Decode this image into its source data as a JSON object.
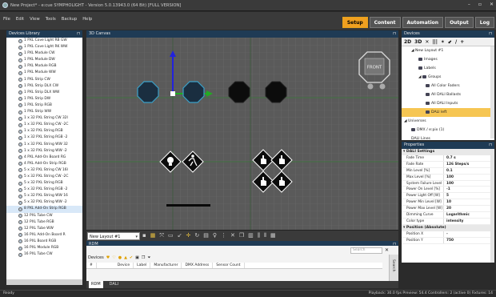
{
  "window": {
    "title": "New Project* - e:cue SYMPHOLIGHT - Version 5.0.13943.0 (64 Bit) [FULL VERSION]"
  },
  "menu": [
    "File",
    "Edit",
    "View",
    "Tools",
    "Backup",
    "Help"
  ],
  "tabs": [
    {
      "label": "Setup",
      "active": true
    },
    {
      "label": "Content",
      "active": false
    },
    {
      "label": "Automation",
      "active": false
    },
    {
      "label": "Output",
      "active": false
    },
    {
      "label": "Log",
      "active": false
    }
  ],
  "library": {
    "title": "Devices Library",
    "items": [
      "1 PXL Cove Light RB GW",
      "1 PXL Cove Light RK WW",
      "1 PXL Module CW",
      "1 PXL Module DW",
      "1 PXL Module RGB",
      "1 PXL Module WW",
      "1 PXL Strip CW",
      "1 PXL Strip DLX CW",
      "1 PXL Strip DLX WW",
      "1 PXL Strip DW",
      "1 PXL Strip RGB",
      "1 PXL Strip WW",
      "1 x 32 PXL String CW 32I",
      "1 x 32 PXL String CW -2C",
      "1 x 32 PXL String RGB",
      "1 x 32 PXL String RGB -2",
      "1 x 32 PXL String WW 32",
      "1 x 32 PXL String WW -2",
      "4 PXL Add-On Board RG",
      "4 PXL Add-On Strip RGB",
      "5 x 32 PXL String CW 16I",
      "5 x 32 PXL String CW -2C",
      "5 x 32 PXL String RGB",
      "5 x 32 PXL String RGB -2",
      "5 x 32 PXL String WW 16",
      "5 x 32 PXL String WW -2",
      "8 PXL Add-On Strip RGB",
      "12 PXL Tube CW",
      "12 PXL Tube RGB",
      "12 PXL Tube WW",
      "16 PXL Add-On Board R",
      "16 PXL Board RGB",
      "16 PXL Module RGB",
      "16 PXL Tube CW"
    ],
    "selected_index": 26
  },
  "canvas": {
    "title": "3D Canvas",
    "view_label": "FRONT"
  },
  "toolbar3d": {
    "layout_value": "New Layout #1"
  },
  "rdm": {
    "title": "RDM",
    "toolbar_label": "Devices",
    "search_placeholder": "Search",
    "columns": [
      "#",
      "Device",
      "Label",
      "Manufacturer",
      "DMX Address",
      "Sensor Count"
    ],
    "side_label": "Search"
  },
  "bottom_tabs": [
    "RDM",
    "DALI"
  ],
  "devices_panel": {
    "title": "Devices",
    "tools": [
      "2D",
      "3D",
      "✕",
      "|||",
      "✶",
      "⬋",
      "/",
      "+"
    ],
    "tree": [
      {
        "label": "New Layout #1",
        "indent": 1,
        "icon": false
      },
      {
        "label": "Images",
        "indent": 2,
        "icon": true
      },
      {
        "label": "Labels",
        "indent": 2,
        "icon": true
      },
      {
        "label": "Groups",
        "indent": 2,
        "icon": true
      },
      {
        "label": "All Color Faders",
        "indent": 3,
        "icon": true
      },
      {
        "label": "All DALI Ballasts",
        "indent": 3,
        "icon": true
      },
      {
        "label": "All DALI Inputs",
        "indent": 3,
        "icon": true
      },
      {
        "label": "DALI left",
        "indent": 3,
        "icon": true,
        "selected": true
      },
      {
        "label": "Universes",
        "indent": 0,
        "icon": false
      },
      {
        "label": "DMX / e:pix (1)",
        "indent": 1,
        "icon": true
      },
      {
        "label": "DALI Lines",
        "indent": 1,
        "icon": false
      }
    ]
  },
  "properties": {
    "title": "Properties",
    "section1": "DALI Settings",
    "rows": [
      {
        "k": "Fade Time",
        "v": "0.7 s"
      },
      {
        "k": "Fade Rate",
        "v": "126 Steps/s"
      },
      {
        "k": "Min Level [%]",
        "v": "0.1"
      },
      {
        "k": "Max Level [%]",
        "v": "100"
      },
      {
        "k": "System Failure Level",
        "v": "100"
      },
      {
        "k": "Power On Level [%]",
        "v": "-1"
      },
      {
        "k": "Power Light Off [W]",
        "v": "5"
      },
      {
        "k": "Power Min Level [W]",
        "v": "10"
      },
      {
        "k": "Power Max Level [W]",
        "v": "20"
      },
      {
        "k": "Dimming Curve",
        "v": "Logarithmic"
      },
      {
        "k": "Color type",
        "v": "intensity"
      }
    ],
    "section2": "Position (Absolute)",
    "rows2": [
      {
        "k": "Position X",
        "v": "-"
      },
      {
        "k": "Position Y",
        "v": "750"
      }
    ]
  },
  "status": {
    "left": "Ready",
    "right": "Playback: 30.0 fps   Preview: 54.4   Controllers: 2 (active 0)   Fixtures: 14"
  },
  "colors": {
    "accent": "#f0a020",
    "panel_header": "#1f3b55",
    "selected_row": "#f6c653"
  }
}
